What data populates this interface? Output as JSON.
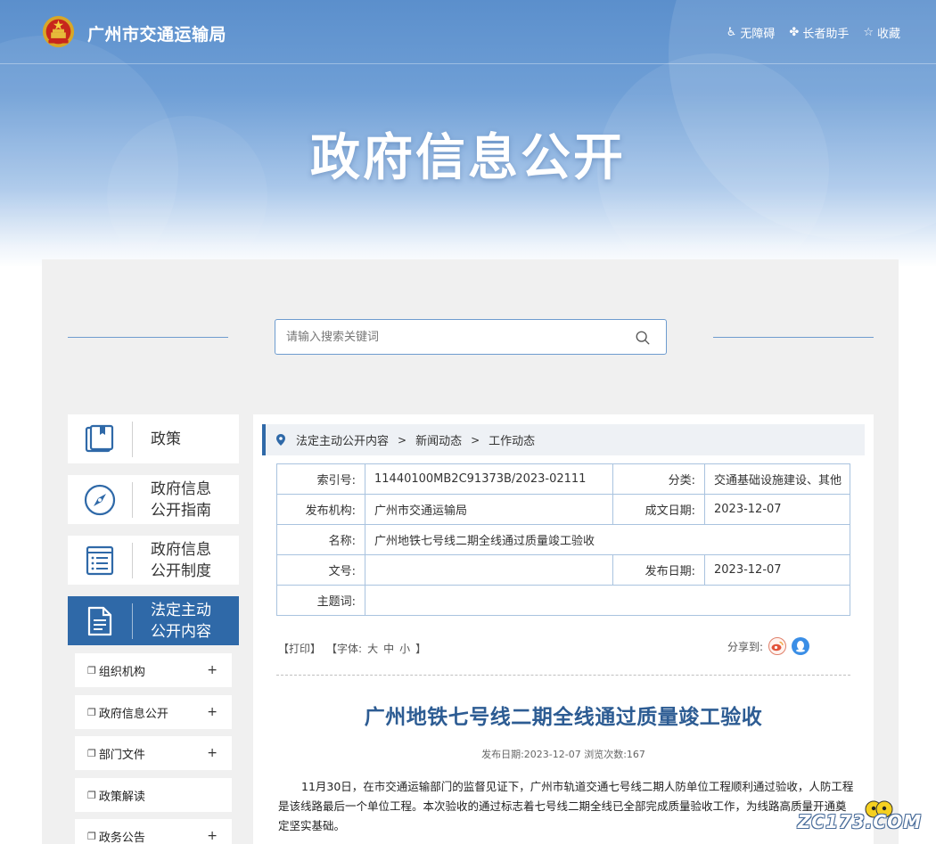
{
  "header": {
    "site_title": "广州市交通运输局",
    "tools": [
      {
        "icon": "accessibility-icon",
        "glyph": "♿",
        "label": "无障碍"
      },
      {
        "icon": "elderly-assist-icon",
        "glyph": "✤",
        "label": "长者助手"
      },
      {
        "icon": "star-icon",
        "glyph": "☆",
        "label": "收藏"
      }
    ]
  },
  "hero": {
    "title": "政府信息公开"
  },
  "search": {
    "placeholder": "请输入搜索关键词"
  },
  "menu": {
    "big_items": [
      {
        "label": "政策",
        "icon": "book-icon",
        "active": false
      },
      {
        "label": "政府信息公开指南",
        "icon": "compass-icon",
        "active": false
      },
      {
        "label": "政府信息公开制度",
        "icon": "list-document-icon",
        "active": false
      },
      {
        "label": "法定主动公开内容",
        "icon": "document-icon",
        "active": true
      }
    ],
    "sub_items": [
      {
        "label": "组织机构",
        "expandable": true,
        "plus": "+"
      },
      {
        "label": "政府信息公开",
        "expandable": true,
        "plus": "+"
      },
      {
        "label": "部门文件",
        "expandable": true,
        "plus": "+"
      },
      {
        "label": "政策解读",
        "expandable": false,
        "plus": ""
      },
      {
        "label": "政务公告",
        "expandable": true,
        "plus": "+"
      }
    ]
  },
  "breadcrumb": {
    "items": [
      "法定主动公开内容",
      "新闻动态",
      "工作动态"
    ],
    "separator": ">"
  },
  "meta": {
    "index_label": "索引号:",
    "index_value": "11440100MB2C91373B/2023-02111",
    "category_label": "分类:",
    "category_value": "交通基础设施建设、其他",
    "publisher_label": "发布机构:",
    "publisher_value": "广州市交通运输局",
    "written_label": "成文日期:",
    "written_value": "2023-12-07",
    "name_label": "名称:",
    "name_value": "广州地铁七号线二期全线通过质量竣工验收",
    "docno_label": "文号:",
    "docno_value": "",
    "published_label": "发布日期:",
    "published_value": "2023-12-07",
    "subject_label": "主题词:",
    "subject_value": ""
  },
  "toolbar": {
    "print": "【打印】",
    "font_prefix": "【字体:",
    "font_large": "大",
    "font_medium": "中",
    "font_small": "小",
    "font_suffix": "】",
    "share_label": "分享到:"
  },
  "article": {
    "title": "广州地铁七号线二期全线通过质量竣工验收",
    "meta": "发布日期:2023-12-07  浏览次数:167",
    "body": "11月30日，在市交通运输部门的监督见证下，广州市轨道交通七号线二期人防单位工程顺利通过验收，人防工程是该线路最后一个单位工程。本次验收的通过标志着七号线二期全线已全部完成质量验收工作，为线路高质量开通奠定坚实基础。"
  },
  "watermark": "ZC173.COM",
  "colors": {
    "primary": "#2f69a8",
    "title_blue": "#2d5c93",
    "border_blue": "#a9c3df",
    "panel_gray": "#f0f0f0"
  }
}
